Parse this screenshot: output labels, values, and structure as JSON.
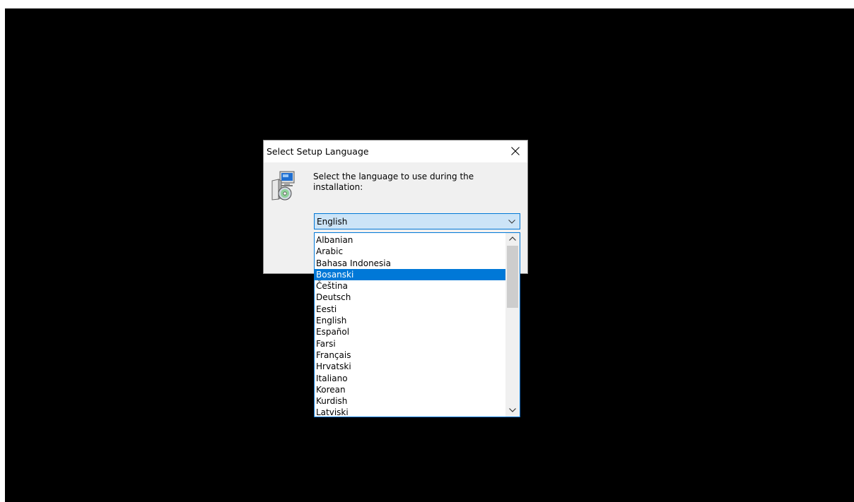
{
  "dialog": {
    "title": "Select Setup Language",
    "message": "Select the language to use during the installation:",
    "icons": {
      "app": "setup-installer-icon",
      "close": "close-icon"
    }
  },
  "language_select": {
    "value": "English",
    "icon": "chevron-down-icon",
    "options": [
      "Albanian",
      "Arabic",
      "Bahasa Indonesia",
      "Bosanski",
      "Čeština",
      "Deutsch",
      "Eesti",
      "English",
      "Español",
      "Farsi",
      "Français",
      "Hrvatski",
      "Italiano",
      "Korean",
      "Kurdish",
      "Latviski"
    ],
    "highlighted": "Bosanski"
  },
  "colors": {
    "accent": "#0078d7",
    "combo_background": "#cce4f7",
    "dialog_background": "#f0f0f0",
    "desktop": "#000000"
  }
}
